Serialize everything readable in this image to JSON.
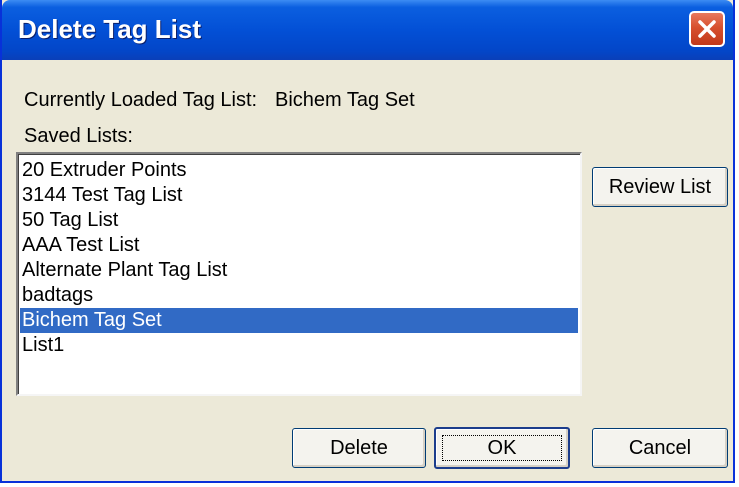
{
  "window": {
    "title": "Delete Tag List"
  },
  "current": {
    "label": "Currently Loaded Tag List:",
    "value": "Bichem Tag Set"
  },
  "saved": {
    "label": "Saved Lists:",
    "items": [
      "20 Extruder Points",
      "3144 Test Tag List",
      "50 Tag List",
      "AAA Test List",
      "Alternate Plant Tag List",
      "badtags",
      "Bichem Tag Set",
      "List1"
    ],
    "selected_item": "Bichem Tag Set"
  },
  "buttons": {
    "review": "Review List",
    "delete": "Delete",
    "ok": "OK",
    "cancel": "Cancel"
  },
  "colors": {
    "titlebar": "#0350d6",
    "selection": "#316ac5",
    "dialog_bg": "#ece9d8",
    "close_button": "#d7502e"
  },
  "icons": {
    "close": "close-icon"
  }
}
